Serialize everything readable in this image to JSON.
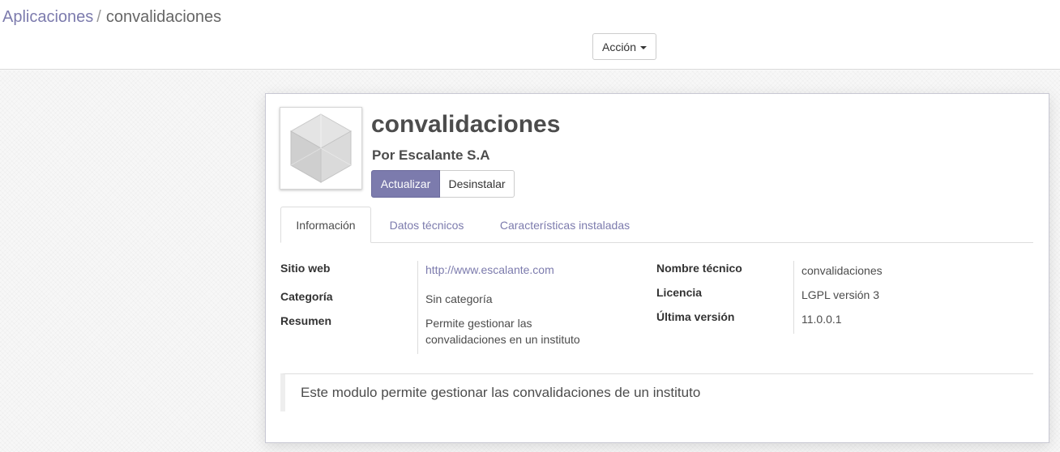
{
  "breadcrumb": {
    "parent": "Aplicaciones",
    "separator": "/",
    "current": "convalidaciones"
  },
  "toolbar": {
    "action_label": "Acción"
  },
  "module": {
    "icon": "cube-icon",
    "name": "convalidaciones",
    "author": "Por Escalante S.A",
    "upgrade_label": "Actualizar",
    "uninstall_label": "Desinstalar"
  },
  "tabs": [
    {
      "label": "Información",
      "active": true
    },
    {
      "label": "Datos técnicos",
      "active": false
    },
    {
      "label": "Características instaladas",
      "active": false
    }
  ],
  "info": {
    "website_label": "Sitio web",
    "website_value": "http://www.escalante.com",
    "category_label": "Categoría",
    "category_value": "Sin categoría",
    "summary_label": "Resumen",
    "summary_line1": "Permite gestionar las",
    "summary_line2": "convalidaciones en un instituto",
    "technical_name_label": "Nombre técnico",
    "technical_name_value": "convalidaciones",
    "license_label": "Licencia",
    "license_value": "LGPL versión 3",
    "version_label": "Última versión",
    "version_value": "11.0.0.1"
  },
  "description": "Este modulo permite gestionar las convalidaciones de un instituto",
  "colors": {
    "accent": "#7c7bad",
    "text": "#4c4c4c",
    "border": "#dddddd"
  }
}
